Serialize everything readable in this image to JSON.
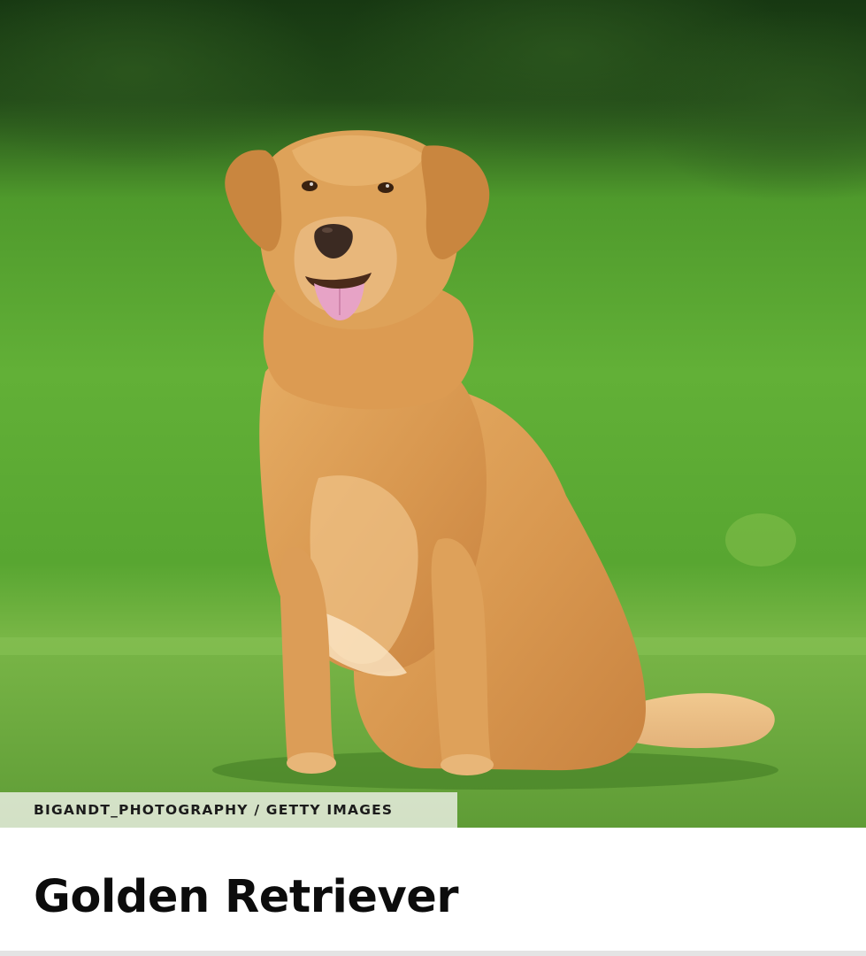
{
  "photo": {
    "subject": "golden-retriever",
    "credit": "BIGANDT_PHOTOGRAPHY / GETTY IMAGES"
  },
  "article": {
    "title": "Golden Retriever"
  },
  "colors": {
    "grass": "#5aa832",
    "foliage": "#1d3d14",
    "fur": "#d99a52",
    "tongue": "#e7a3c6",
    "title_text": "#0c0c0c",
    "credit_bg": "#e6ecde"
  }
}
